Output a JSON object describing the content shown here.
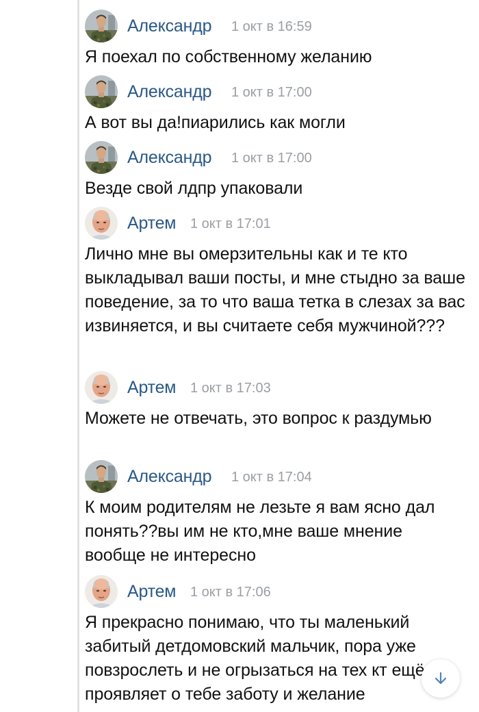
{
  "messages": [
    {
      "author": "Александр",
      "time": "1 окт в 16:59",
      "text": "Я поехал по собственному желанию",
      "avatar": "soldier-avatar"
    },
    {
      "author": "Александр",
      "time": "1 окт в 17:00",
      "text": "А вот вы да!пиарились как могли",
      "avatar": "soldier-avatar"
    },
    {
      "author": "Александр",
      "time": "1 окт в 17:00",
      "text": "Везде свой лдпр упаковали",
      "avatar": "soldier-avatar"
    },
    {
      "author": "Артем",
      "time": "1 окт в 17:01",
      "text": "Лично мне вы омерзительны как и те кто выкладывал ваши посты, и мне стыдно за ваше поведение, за то что ваша тетка в слезах за вас извиняется, и вы считаете себя мужчиной???",
      "avatar": "bald-man-avatar"
    },
    {
      "author": "Артем",
      "time": "1 окт в 17:03",
      "text": "Можете не отвечать, это вопрос к раздумью",
      "avatar": "bald-man-avatar"
    },
    {
      "author": "Александр",
      "time": "1 окт в 17:04",
      "text": "К моим родителям не лезьте я вам ясно дал понять??вы им не кто,мне ваше мнение вообще не интересно",
      "avatar": "soldier-avatar"
    },
    {
      "author": "Артем",
      "time": "1 окт в 17:06",
      "text": "Я прекрасно понимаю, что ты маленький забитый детдомовский мальчик, пора уже повзрослеть и не огрызаться на тех кт ещё проявляет о тебе заботу и желание",
      "avatar": "bald-man-avatar"
    }
  ],
  "scroll_button": {
    "icon": "arrow-down-icon"
  },
  "colors": {
    "author": "#2a5885",
    "time": "#9a9ea3",
    "text": "#111111",
    "accent": "#5181b8"
  }
}
